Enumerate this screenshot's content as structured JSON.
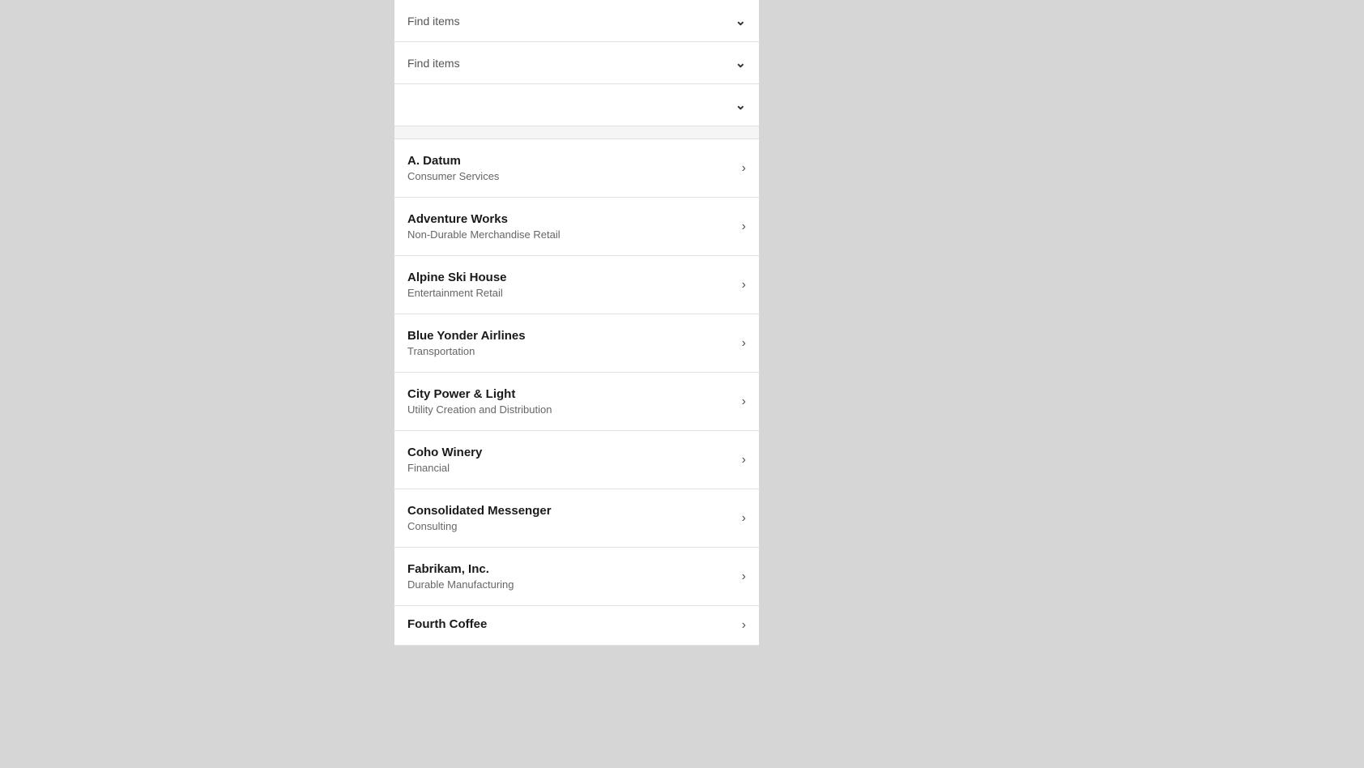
{
  "dropdowns": [
    {
      "label": "Find items",
      "hasLabel": true
    },
    {
      "label": "Find items",
      "hasLabel": true
    },
    {
      "label": "",
      "hasLabel": false
    }
  ],
  "listItems": [
    {
      "title": "A. Datum",
      "subtitle": "Consumer Services"
    },
    {
      "title": "Adventure Works",
      "subtitle": "Non-Durable Merchandise Retail"
    },
    {
      "title": "Alpine Ski House",
      "subtitle": "Entertainment Retail"
    },
    {
      "title": "Blue Yonder Airlines",
      "subtitle": "Transportation"
    },
    {
      "title": "City Power & Light",
      "subtitle": "Utility Creation and Distribution"
    },
    {
      "title": "Coho Winery",
      "subtitle": "Financial"
    },
    {
      "title": "Consolidated Messenger",
      "subtitle": "Consulting"
    },
    {
      "title": "Fabrikam, Inc.",
      "subtitle": "Durable Manufacturing"
    },
    {
      "title": "Fourth Coffee",
      "subtitle": ""
    }
  ],
  "icons": {
    "chevronDown": "⌄",
    "chevronRight": "›"
  }
}
